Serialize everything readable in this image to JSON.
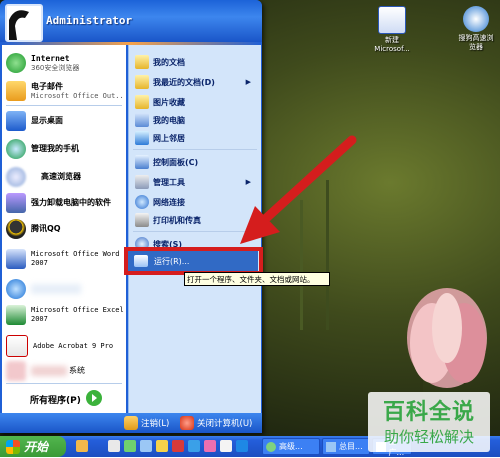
{
  "user": {
    "name": "Administrator"
  },
  "desktop_icons": [
    {
      "label": "新建\nMicrosof...",
      "icon": "word-doc-icon"
    },
    {
      "label": "搜狗高速浏\n览器",
      "icon": "sogou-browser-icon"
    }
  ],
  "left_items": [
    {
      "title": "Internet",
      "subtitle": "360安全浏览器",
      "icon": "browser-icon"
    },
    {
      "title": "电子邮件",
      "subtitle": "Microsoft Office Out...",
      "icon": "outlook-icon"
    },
    {
      "title": "显示桌面",
      "subtitle": "",
      "icon": "desktop-icon"
    },
    {
      "title": "管理我的手机",
      "subtitle": "",
      "icon": "phone-manager-icon"
    },
    {
      "title": "高速浏览器",
      "subtitle": "",
      "icon": "fast-browser-icon"
    },
    {
      "title": "强力卸载电脑中的软件",
      "subtitle": "",
      "icon": "uninstall-icon"
    },
    {
      "title": "腾讯QQ",
      "subtitle": "",
      "icon": "qq-icon"
    },
    {
      "title": "Microsoft Office Word 2007",
      "subtitle": "",
      "icon": "word-icon"
    },
    {
      "title": "",
      "subtitle": "",
      "icon": "ie-icon"
    },
    {
      "title": "Microsoft Office Excel 2007",
      "subtitle": "",
      "icon": "excel-icon"
    },
    {
      "title": "Adobe Acrobat 9 Pro",
      "subtitle": "",
      "icon": "acrobat-icon"
    },
    {
      "title": "系统",
      "subtitle": "",
      "icon": "system-icon"
    }
  ],
  "all_programs": "所有程序(P)",
  "right_items": [
    {
      "label": "我的文档",
      "icon": "my-documents-icon"
    },
    {
      "label": "我最近的文档(D)",
      "icon": "recent-docs-icon",
      "arrow": "▶"
    },
    {
      "label": "图片收藏",
      "icon": "my-pictures-icon"
    },
    {
      "label": "我的电脑",
      "icon": "my-computer-icon"
    },
    {
      "label": "网上邻居",
      "icon": "network-icon"
    },
    {
      "label": "控制面板(C)",
      "icon": "control-panel-icon"
    },
    {
      "label": "管理工具",
      "icon": "admin-tools-icon",
      "arrow": "▶"
    },
    {
      "label": "网络连接",
      "icon": "network-connections-icon"
    },
    {
      "label": "打印机和传真",
      "icon": "printers-icon"
    },
    {
      "label": "搜索(S)",
      "icon": "search-icon"
    }
  ],
  "run": {
    "label": "运行(R)...",
    "tooltip": "打开一个程序、文件夹、文档或网站。"
  },
  "footer": {
    "logoff": "注销(L)",
    "shutdown": "关闭计算机(U)"
  },
  "taskbar": {
    "start": "开始",
    "tasks": [
      "高级...",
      "总目...",
      "全广..."
    ]
  },
  "watermark": {
    "line1": "百科全说",
    "line2": "助你轻松解决"
  },
  "colors": {
    "highlight": "#316ac5",
    "annotation": "#d51d1d",
    "taskbar": "#245edb",
    "start_green": "#3a9a36"
  }
}
